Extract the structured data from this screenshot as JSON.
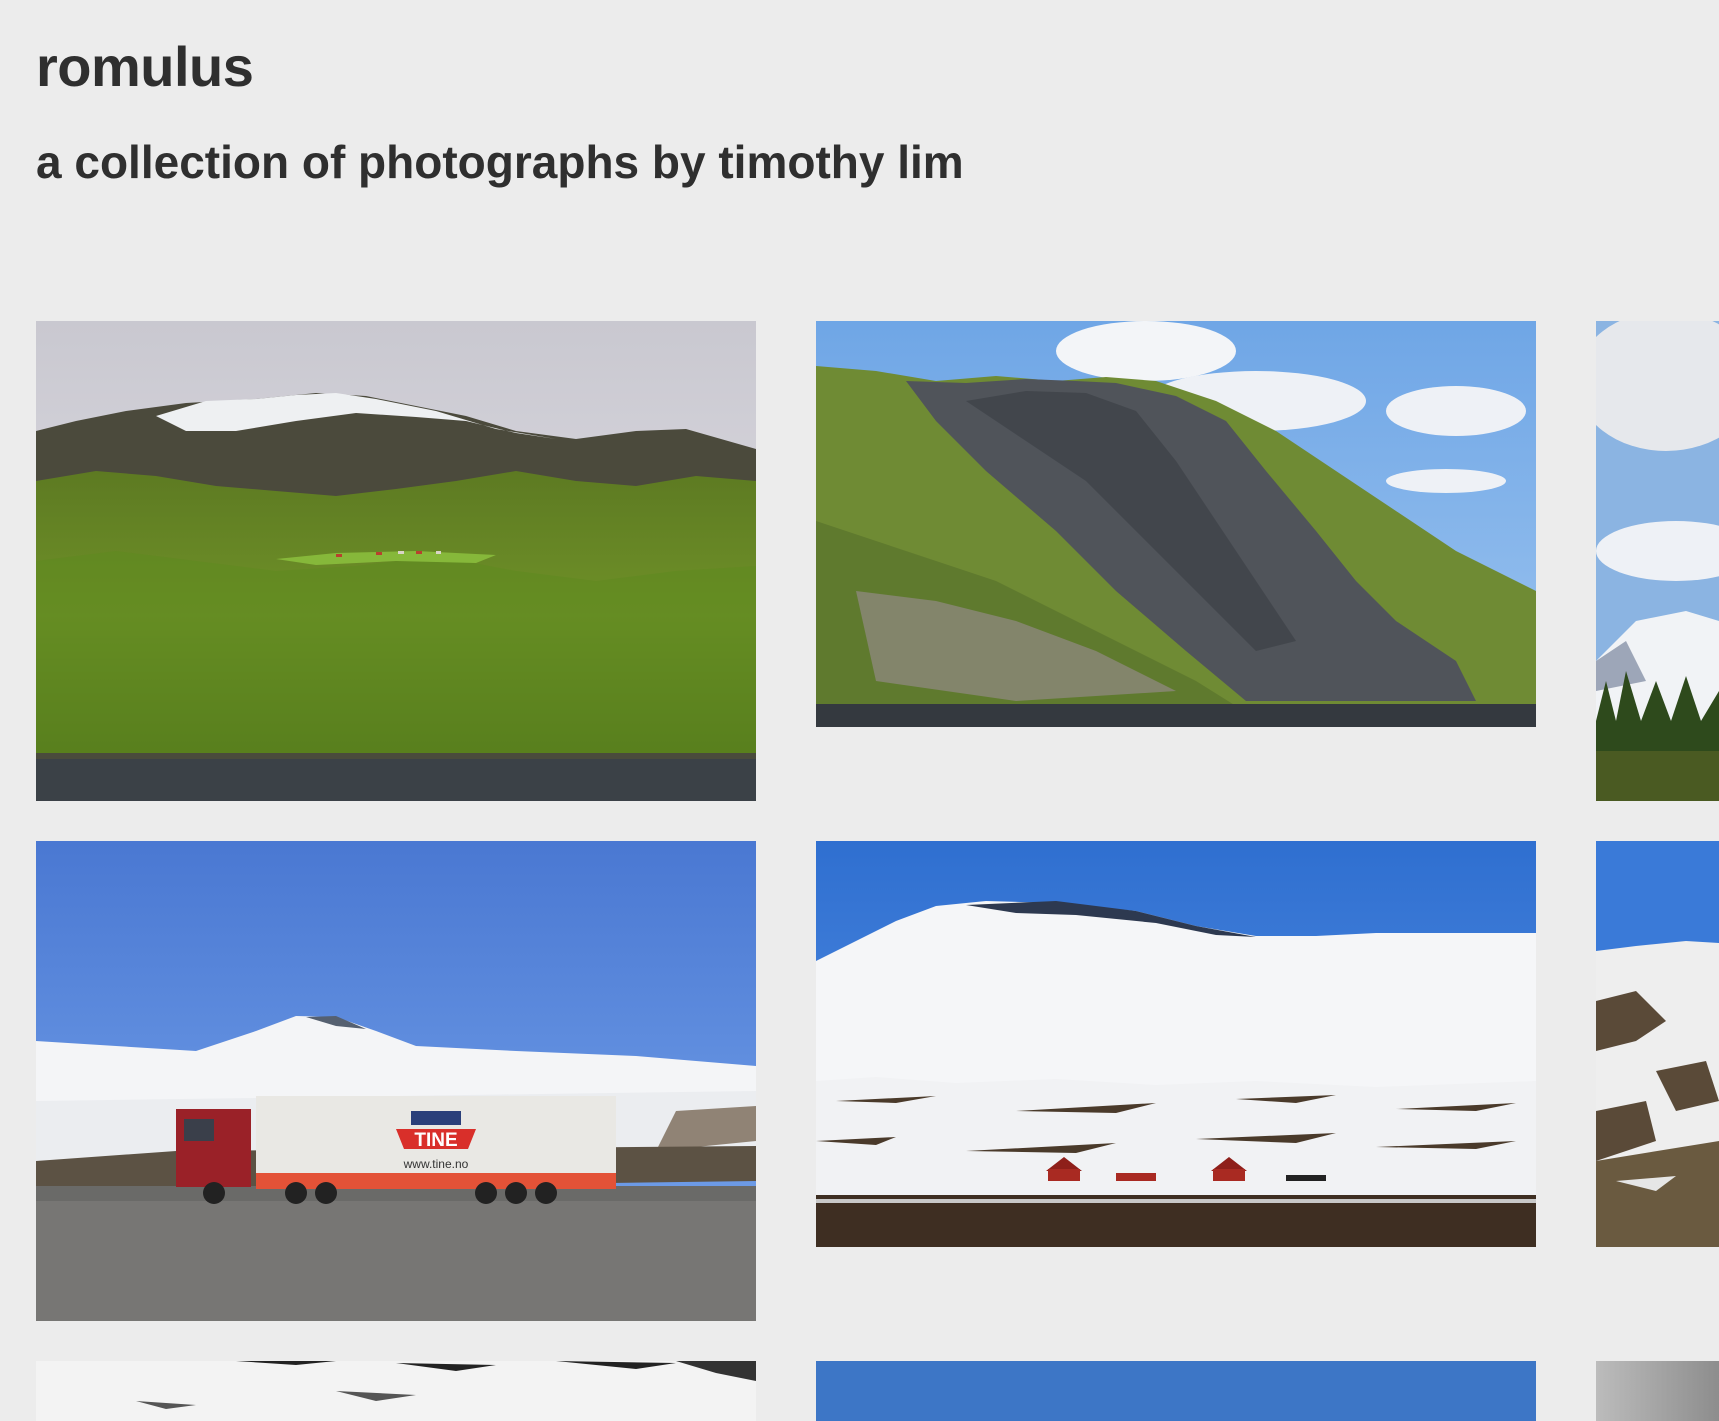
{
  "site": {
    "title": "romulus",
    "subtitle": "a collection of photographs by timothy lim"
  },
  "photos": [
    {
      "subject": "green forested fjord hillside with snowy mountain and farm houses"
    },
    {
      "subject": "dark rock cliff over fjord water under blue sky with clouds"
    },
    {
      "subject": "cloudy sky over snowy peak and pine trees (cropped)"
    },
    {
      "subject": "red truck with white TINE trailer in snowy plateau parking lot",
      "trailer_text": "TINE",
      "trailer_url": "www.tine.no"
    },
    {
      "subject": "snow covered hill with red cabins under blue sky"
    },
    {
      "subject": "snowy slopes with brown patches (cropped)"
    },
    {
      "subject": "snow patches on dark ground (black and white)"
    },
    {
      "subject": "blue sky"
    },
    {
      "subject": "grey sky (cropped)"
    }
  ]
}
